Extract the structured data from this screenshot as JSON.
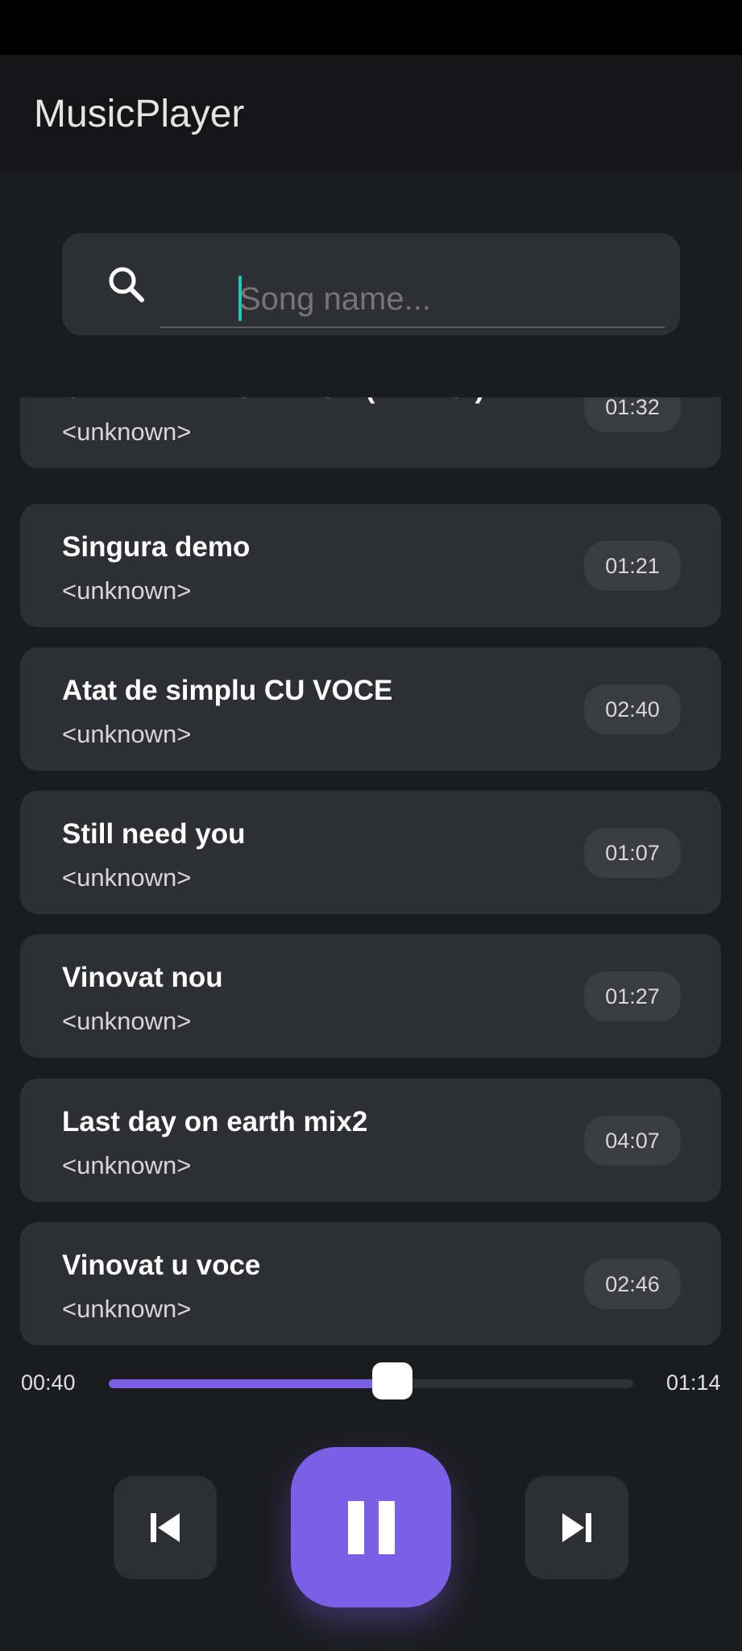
{
  "app": {
    "title": "MusicPlayer"
  },
  "search": {
    "placeholder": "Song name...",
    "value": ""
  },
  "songs": [
    {
      "title": "OANA - TE-AS ALEGE ( DEMO )",
      "artist": "<unknown>",
      "duration": "01:32"
    },
    {
      "title": "Singura demo",
      "artist": "<unknown>",
      "duration": "01:21"
    },
    {
      "title": "Atat de simplu CU VOCE",
      "artist": "<unknown>",
      "duration": "02:40"
    },
    {
      "title": "Still need you",
      "artist": "<unknown>",
      "duration": "01:07"
    },
    {
      "title": "Vinovat nou",
      "artist": "<unknown>",
      "duration": "01:27"
    },
    {
      "title": "Last day on earth mix2",
      "artist": "<unknown>",
      "duration": "04:07"
    },
    {
      "title": "Vinovat u voce",
      "artist": "<unknown>",
      "duration": "02:46"
    }
  ],
  "player": {
    "elapsed": "00:40",
    "total": "01:14",
    "progress_fraction": 0.54,
    "state": "playing"
  },
  "icons": {
    "search": "search-icon",
    "previous": "skip-previous-icon",
    "play_pause": "pause-icon",
    "next": "skip-next-icon"
  },
  "colors": {
    "accent": "#7b5fe6",
    "background": "#1b1c20",
    "card": "#2e2f34",
    "caret": "#22c7b8"
  }
}
